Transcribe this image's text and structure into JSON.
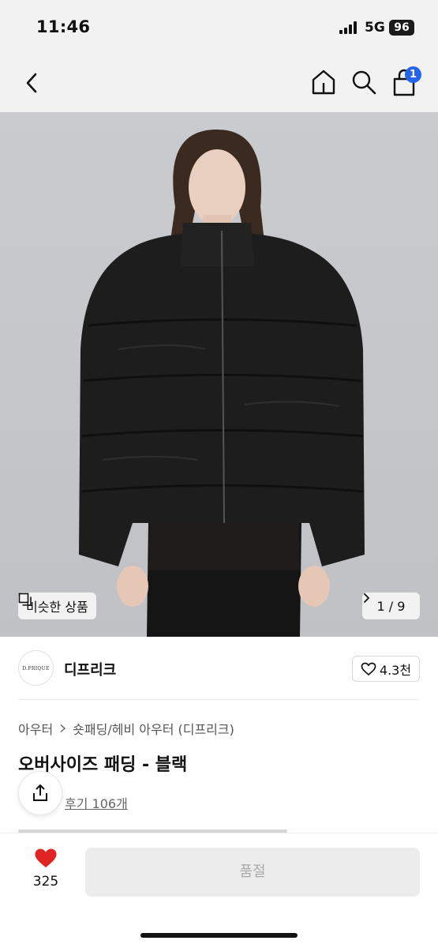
{
  "status": {
    "time": "11:46",
    "network": "5G",
    "battery": "96"
  },
  "nav": {
    "cart_count": "1"
  },
  "hero": {
    "similar_label": "비슷한 상품",
    "counter": "1 / 9"
  },
  "brand": {
    "logo_text": "D.FRIQUE",
    "name": "디프리크",
    "likes": "4.3천"
  },
  "product": {
    "breadcrumb": [
      "아우터",
      "숏패딩/헤비 아우터 (디프리크)"
    ],
    "title": "오버사이즈 패딩 - 블랙",
    "reviews": "후기 106개"
  },
  "bottom": {
    "wish_count": "325",
    "soldout_label": "품절"
  },
  "colors": {
    "accent_blue": "#2563eb",
    "heart_red": "#e02424",
    "soldout_bg": "#ececec"
  },
  "icons": [
    "back-chevron-icon",
    "home-icon",
    "search-icon",
    "cart-icon",
    "similar-icon",
    "chevron-right-icon",
    "heart-outline-icon",
    "share-icon",
    "heart-filled-icon"
  ]
}
